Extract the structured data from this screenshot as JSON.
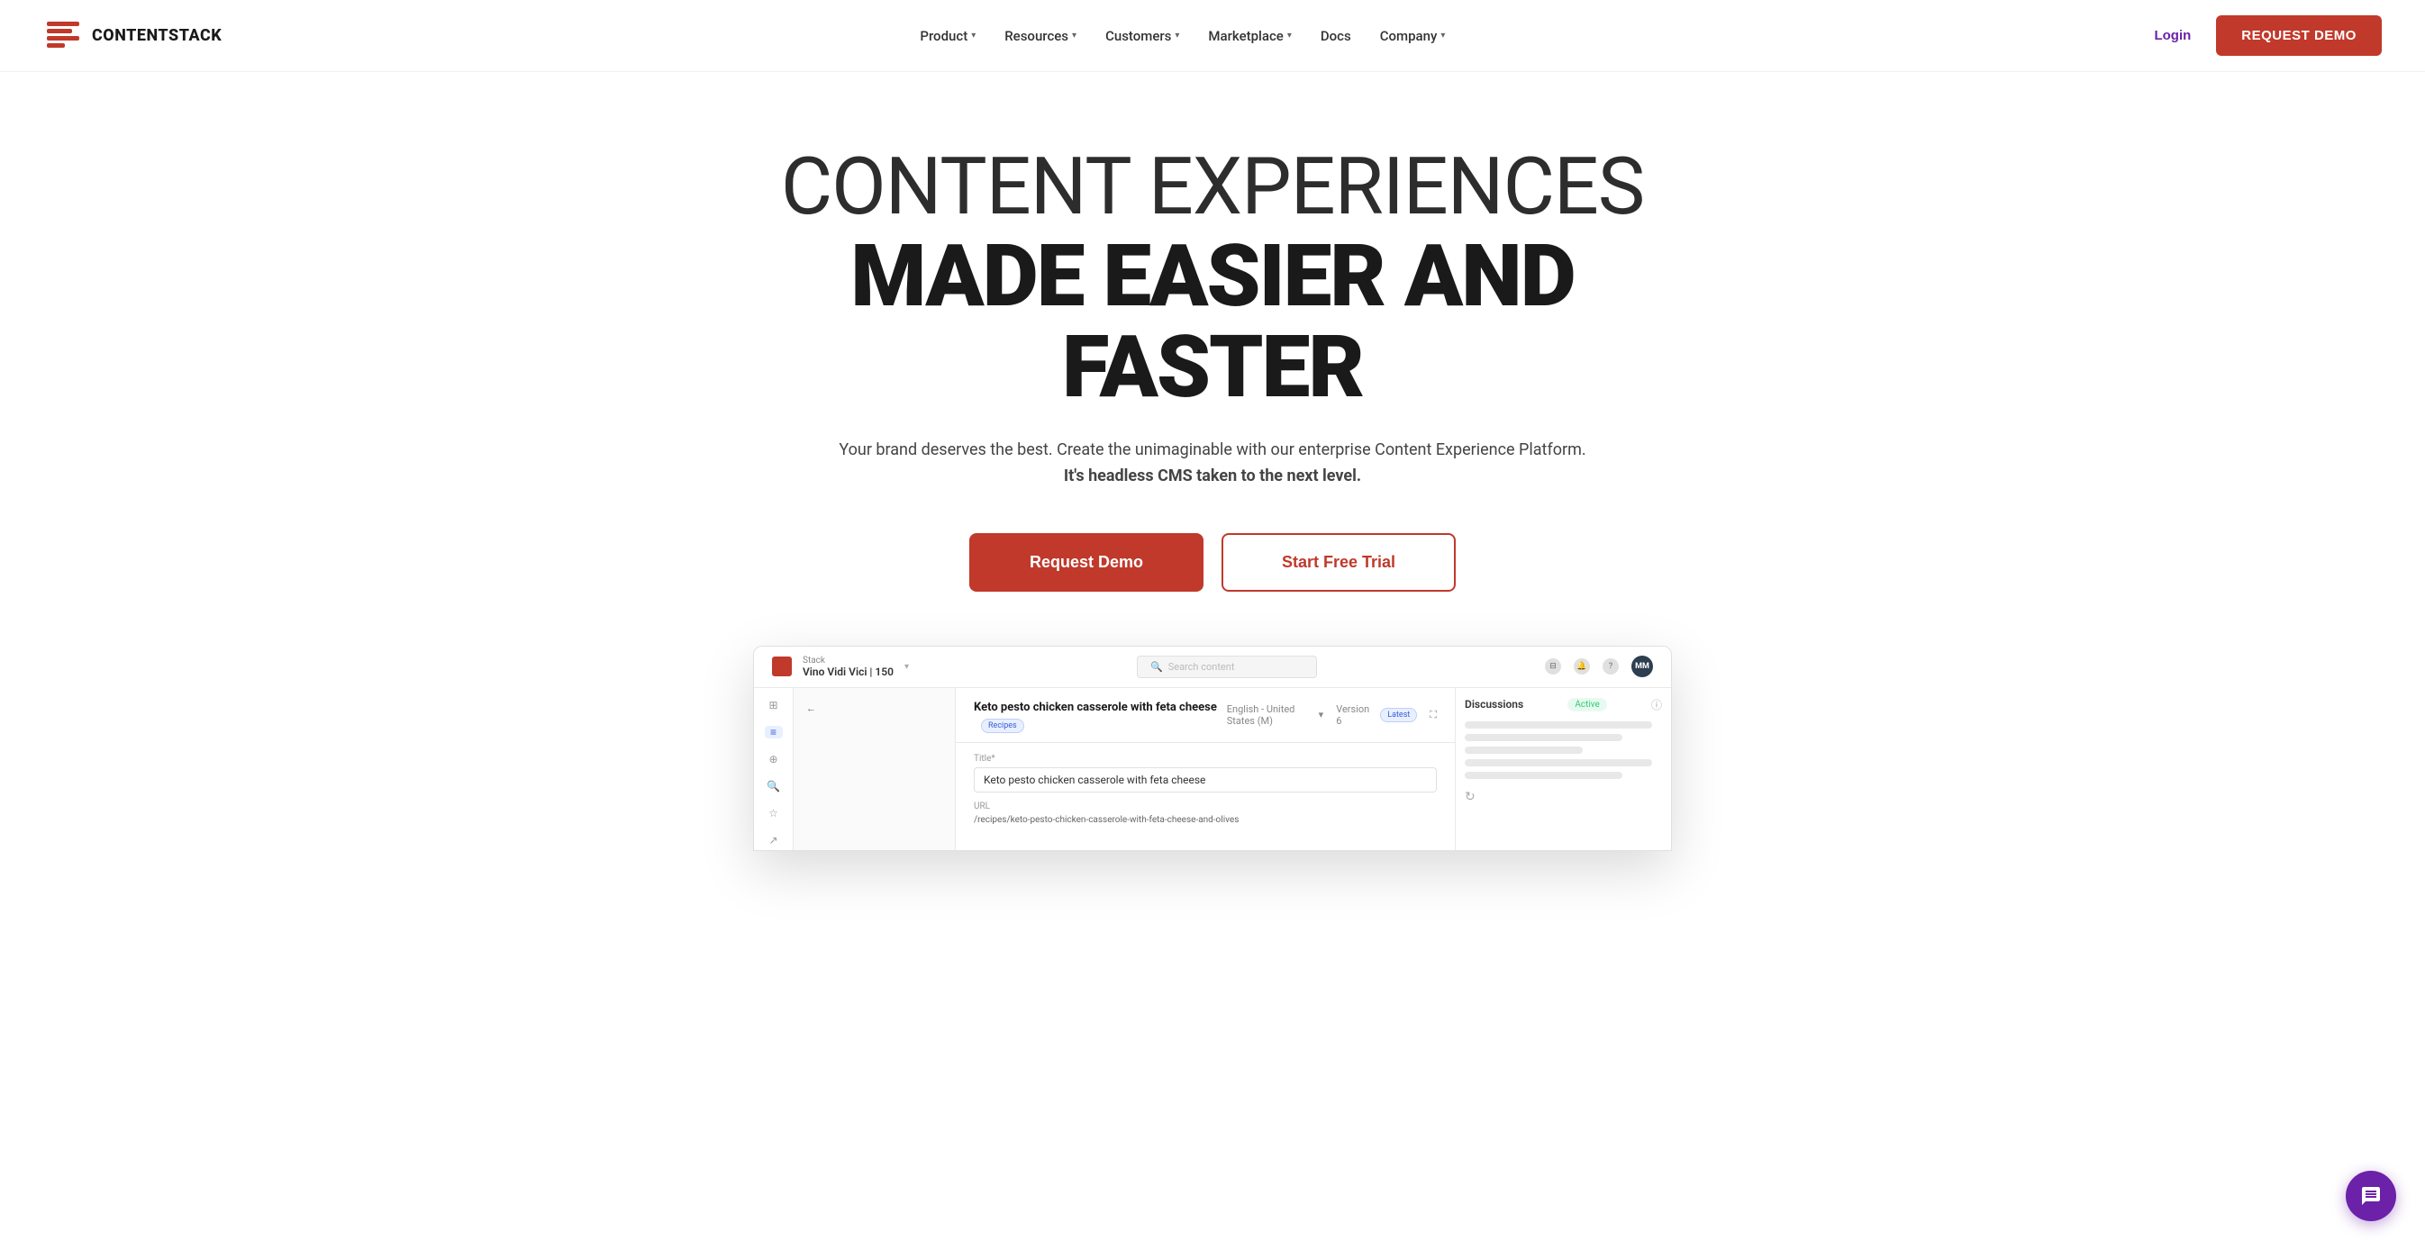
{
  "brand": {
    "name": "CONTENTSTACK",
    "logo_alt": "Contentstack logo"
  },
  "nav": {
    "links": [
      {
        "id": "product",
        "label": "Product",
        "has_dropdown": true
      },
      {
        "id": "resources",
        "label": "Resources",
        "has_dropdown": true
      },
      {
        "id": "customers",
        "label": "Customers",
        "has_dropdown": true
      },
      {
        "id": "marketplace",
        "label": "Marketplace",
        "has_dropdown": true
      },
      {
        "id": "docs",
        "label": "Docs",
        "has_dropdown": false
      },
      {
        "id": "company",
        "label": "Company",
        "has_dropdown": true
      }
    ],
    "login_label": "Login",
    "request_demo_label": "REQUEST DEMO"
  },
  "hero": {
    "title_line1": "CONTENT EXPERIENCES",
    "title_line2": "MADE EASIER AND FASTER",
    "subtitle": "Your brand deserves the best. Create the unimaginable with our enterprise Content Experience Platform.",
    "subtitle_bold": "It's headless CMS taken to the next level.",
    "cta_primary": "Request Demo",
    "cta_secondary": "Start Free Trial"
  },
  "app_preview": {
    "stack_label": "Stack",
    "stack_name": "Vino Vidi Vici | 150",
    "search_placeholder": "Search content",
    "avatar_initials": "MM",
    "entry_title": "Keto pesto chicken casserole with feta cheese",
    "entry_tag": "Recipes",
    "locale": "English - United States (M)",
    "version": "Version 6",
    "version_tag": "Latest",
    "field_title_label": "Title*",
    "field_title_value": "Keto pesto chicken casserole with feta cheese",
    "field_url_label": "URL",
    "field_url_value": "/recipes/keto-pesto-chicken-casserole-with-feta-cheese-and-olives",
    "panel_title": "Discussions",
    "panel_status": "Active"
  },
  "chat_widget": {
    "label": "Chat"
  },
  "colors": {
    "primary_red": "#c0392b",
    "purple": "#6b21a8",
    "nav_text": "#333333"
  }
}
